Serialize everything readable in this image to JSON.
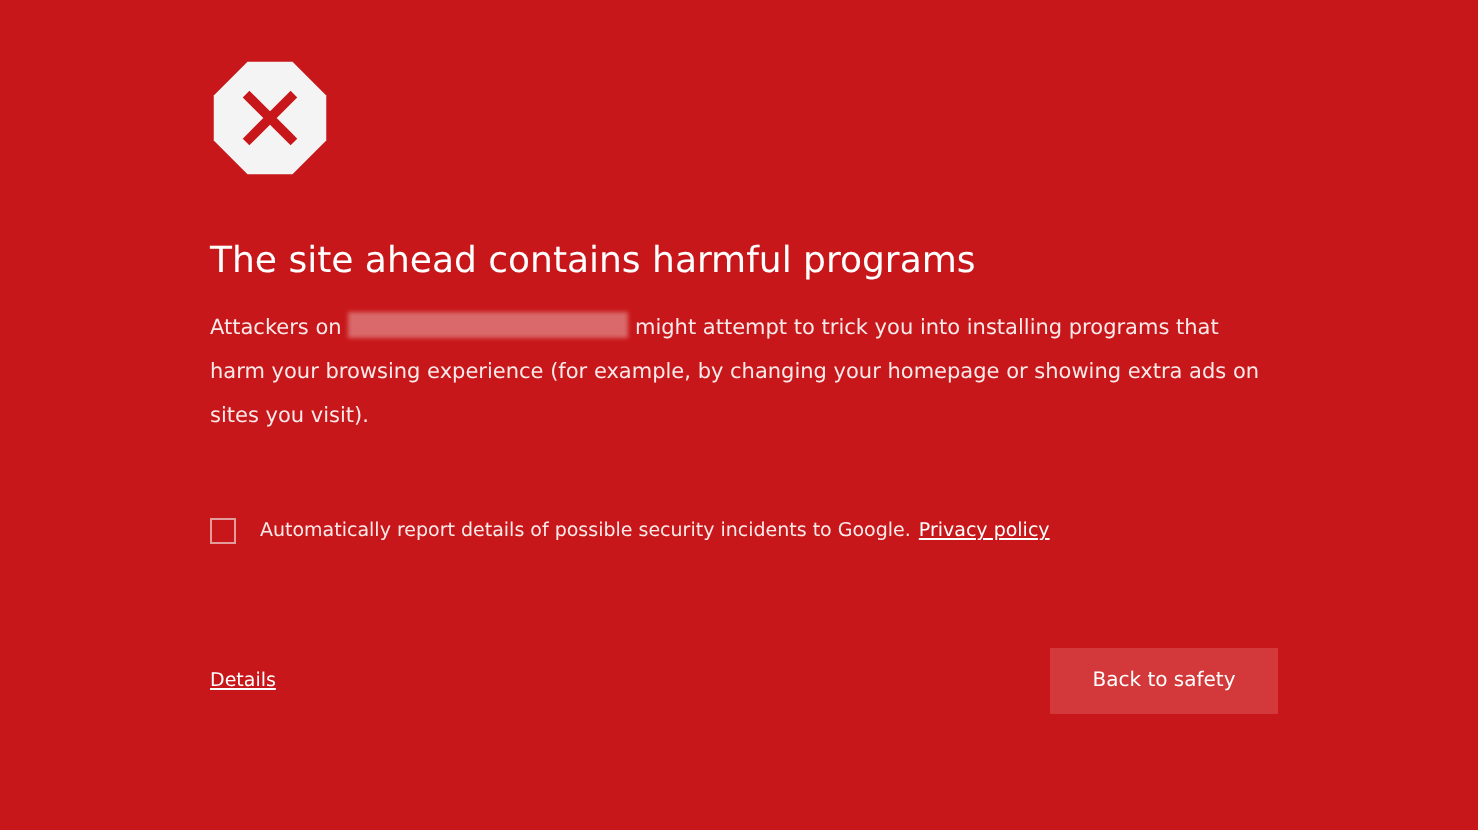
{
  "heading": "The site ahead contains harmful programs",
  "message": {
    "before": "Attackers on",
    "after": "might attempt to trick you into installing programs that harm your browsing experience (for example, by changing your homepage or showing extra ads on sites you visit)."
  },
  "report": {
    "checked": false,
    "label": "Automatically report details of possible security incidents to Google.",
    "link": "Privacy policy"
  },
  "details_link": "Details",
  "primary_button": "Back to safety"
}
